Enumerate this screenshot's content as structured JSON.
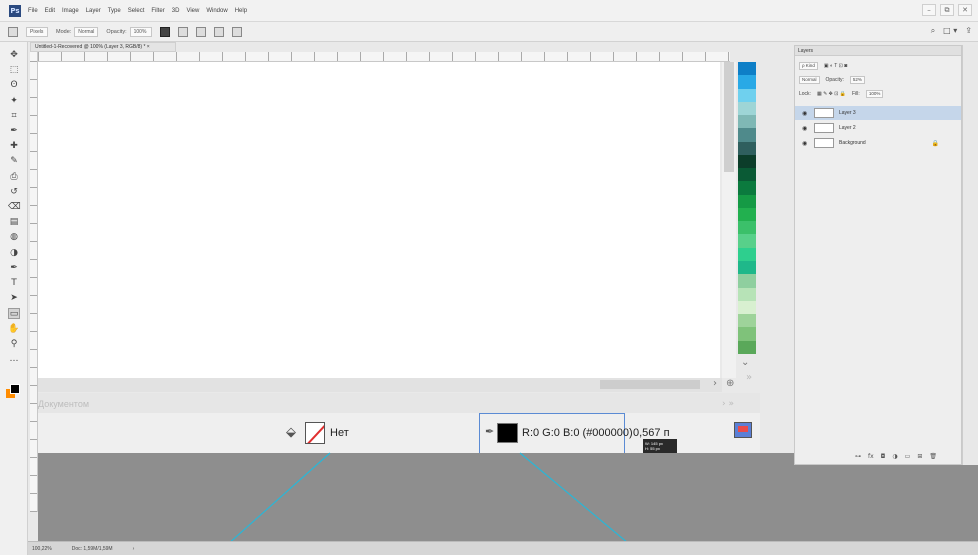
{
  "app": {
    "logo": "Ps"
  },
  "menubar": {
    "items": [
      "File",
      "Edit",
      "Image",
      "Layer",
      "Type",
      "Select",
      "Filter",
      "3D",
      "View",
      "Window",
      "Help"
    ],
    "controls": [
      "–",
      "⧉",
      "✕"
    ]
  },
  "options": {
    "style_label": "Pixels",
    "mode_label": "Mode:",
    "mode_value": "Normal",
    "opacity_label": "Opacity:",
    "opacity_value": "100%",
    "right_icons": [
      "⌕",
      "□ ▾",
      "⇪"
    ]
  },
  "document": {
    "tab_title": "Untitled-1-Recovered @ 100% (Layer 3, RGB/8) * ×",
    "info_label": "Документом"
  },
  "status_zoom": {
    "no_label": "Нет",
    "rgb_text": "R:0 G:0 B:0 (#000000)",
    "value_text": "0,567 п",
    "tooltip_w": "W: 145 px",
    "tooltip_h": "H: 55 px"
  },
  "statusbar": {
    "zoom": "100,22%",
    "doc": "Doc: 1,59M/1,59M",
    "arrow": "›"
  },
  "layers": {
    "tab_title": "Layers",
    "kind_label": "ρ Kind",
    "blend_mode": "Normal",
    "opacity_label": "Opacity:",
    "opacity_value": "52%",
    "lock_label": "Lock:",
    "fill_label": "Fill:",
    "fill_value": "100%",
    "items": [
      {
        "name": "Layer 3",
        "selected": true
      },
      {
        "name": "Layer 2",
        "selected": false
      },
      {
        "name": "Background",
        "selected": false,
        "locked": true
      }
    ],
    "footer_icons": [
      "⊶",
      "fx",
      "◘",
      "◑",
      "▭",
      "⊞",
      "🗑"
    ]
  },
  "swatches": {
    "colors": [
      "#0e7fc7",
      "#29a9e6",
      "#6fd0ee",
      "#9ed5d6",
      "#7fb8b5",
      "#4f8a8b",
      "#2f5f5e",
      "#0c3d2a",
      "#0a5a35",
      "#0b7a3e",
      "#159a45",
      "#22b04f",
      "#3bc06a",
      "#58d08a",
      "#2ecf8e",
      "#1fb88a",
      "#8fcf9f",
      "#b7e3b7",
      "#d8f0d0",
      "#9ed39a",
      "#7fc27a",
      "#5aa85a"
    ]
  },
  "colors": {
    "accent": "#5b8bd4",
    "callout_line": "#2ab6d6",
    "selected_layer": "#c5d6ea"
  },
  "icons": {
    "tools": [
      "move-icon",
      "marquee-icon",
      "lasso-icon",
      "magic-wand-icon",
      "crop-icon",
      "eyedropper-icon",
      "healing-brush-icon",
      "brush-icon",
      "clone-stamp-icon",
      "history-brush-icon",
      "eraser-icon",
      "gradient-icon",
      "blur-icon",
      "dodge-icon",
      "pen-icon",
      "type-icon",
      "path-selection-icon",
      "rectangle-icon",
      "hand-icon",
      "zoom-icon",
      "more-tools-icon"
    ]
  }
}
